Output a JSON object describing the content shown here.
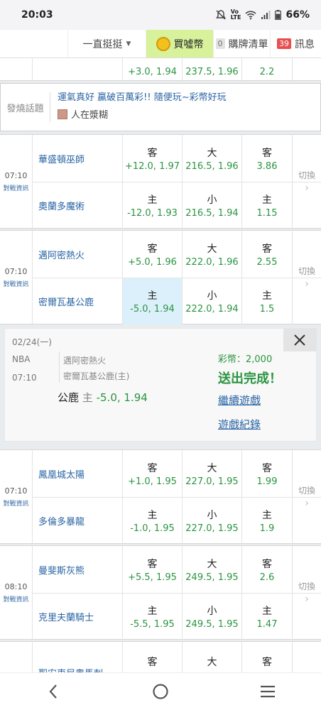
{
  "status": {
    "time": "20:03",
    "battery": "66%"
  },
  "nav": {
    "dropdown_label": "一直挺挺",
    "buy_label": "買噓幣",
    "cart_badge": "0",
    "cart_label": "購牌清單",
    "msg_badge": "39",
    "msg_label": "訊息"
  },
  "partial_row": {
    "odd1": "+3.0, 1.94",
    "odd2": "237.5, 1.96",
    "odd3": "2.2"
  },
  "topic": {
    "label": "發燒話題",
    "headline": "運氣真好 贏破百萬彩!! 隨便玩~彩幣好玩",
    "user": "人在漿糊"
  },
  "switch_label": "切換",
  "info_label": "對戰資訊",
  "games": [
    {
      "time": "07:10",
      "away": {
        "team": "華盛頓巫師",
        "o1_lbl": "客",
        "o1": "+12.0, 1.97",
        "o2_lbl": "大",
        "o2": "216.5, 1.96",
        "o3_lbl": "客",
        "o3": "3.86"
      },
      "home": {
        "team": "奧蘭多魔術",
        "o1_lbl": "主",
        "o1": "-12.0, 1.93",
        "o2_lbl": "小",
        "o2": "216.5, 1.94",
        "o3_lbl": "主",
        "o3": "1.15"
      }
    },
    {
      "time": "07:10",
      "away": {
        "team": "邁阿密熱火",
        "o1_lbl": "客",
        "o1": "+5.0, 1.96",
        "o2_lbl": "大",
        "o2": "222.0, 1.96",
        "o3_lbl": "客",
        "o3": "2.55"
      },
      "home": {
        "team": "密爾瓦基公鹿",
        "o1_lbl": "主",
        "o1": "-5.0, 1.94",
        "o2_lbl": "小",
        "o2": "222.0, 1.94",
        "o3_lbl": "主",
        "o3": "1.5"
      }
    },
    {
      "time": "07:10",
      "away": {
        "team": "鳳凰城太陽",
        "o1_lbl": "客",
        "o1": "+1.0, 1.95",
        "o2_lbl": "大",
        "o2": "227.0, 1.95",
        "o3_lbl": "客",
        "o3": "1.99"
      },
      "home": {
        "team": "多倫多暴龍",
        "o1_lbl": "主",
        "o1": "-1.0, 1.95",
        "o2_lbl": "小",
        "o2": "227.0, 1.95",
        "o3_lbl": "主",
        "o3": "1.9"
      }
    },
    {
      "time": "08:10",
      "away": {
        "team": "曼斐斯灰熊",
        "o1_lbl": "客",
        "o1": "+5.5, 1.95",
        "o2_lbl": "大",
        "o2": "249.5, 1.95",
        "o3_lbl": "客",
        "o3": "2.6"
      },
      "home": {
        "team": "克里夫蘭騎士",
        "o1_lbl": "主",
        "o1": "-5.5, 1.95",
        "o2_lbl": "小",
        "o2": "249.5, 1.95",
        "o3_lbl": "主",
        "o3": "1.47"
      }
    },
    {
      "time": "",
      "away": {
        "team": "聖安東尼奧馬刺",
        "o1_lbl": "客",
        "o1": "",
        "o2_lbl": "大",
        "o2": "",
        "o3_lbl": "客",
        "o3": ""
      },
      "home": {
        "team": "",
        "o1_lbl": "",
        "o1": "",
        "o2_lbl": "",
        "o2": "",
        "o3_lbl": "",
        "o3": ""
      }
    }
  ],
  "popup": {
    "date": "02/24(一)",
    "league": "NBA",
    "time": "07:10",
    "team1": "邁阿密熱火",
    "team2": "密爾瓦基公鹿(主)",
    "bet_team": "公鹿",
    "bet_side": "主",
    "bet_line": "-5.0, 1.94",
    "coins": "彩幣：2,000",
    "done": "送出完成！",
    "continue": "繼續遊戲",
    "history": "遊戲紀錄"
  }
}
